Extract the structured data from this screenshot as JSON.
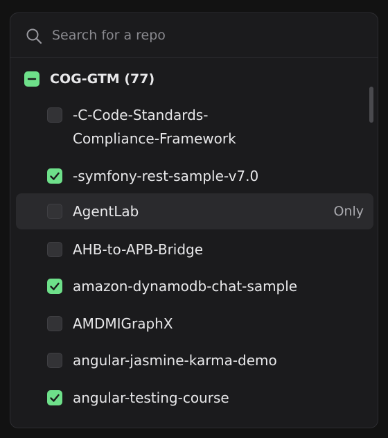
{
  "search": {
    "placeholder": "Search for a repo",
    "value": ""
  },
  "group": {
    "label": "COG-GTM (77)",
    "state": "indeterminate"
  },
  "repos": [
    {
      "line1": "-C-Code-Standards-",
      "line2": "Compliance-Framework",
      "checked": false
    },
    {
      "label": "-symfony-rest-sample-v7.0",
      "checked": true
    },
    {
      "label": "AgentLab",
      "checked": false,
      "hovered": true,
      "only_label": "Only"
    },
    {
      "label": "AHB-to-APB-Bridge",
      "checked": false
    },
    {
      "label": "amazon-dynamodb-chat-sample",
      "checked": true
    },
    {
      "label": "AMDMIGraphX",
      "checked": false
    },
    {
      "label": "angular-jasmine-karma-demo",
      "checked": false
    },
    {
      "label": "angular-testing-course",
      "checked": true
    }
  ],
  "colors": {
    "accent": "#6ee08a",
    "background": "#1b1b1d",
    "hover": "#2a2a2d"
  }
}
